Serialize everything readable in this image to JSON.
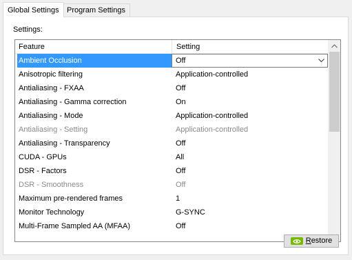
{
  "tabs": [
    {
      "label": "Global Settings"
    },
    {
      "label": "Program Settings"
    }
  ],
  "settings_label": "Settings:",
  "table": {
    "columns": [
      "Feature",
      "Setting"
    ],
    "rows": [
      {
        "feature": "Ambient Occlusion",
        "setting": "Off"
      },
      {
        "feature": "Anisotropic filtering",
        "setting": "Application-controlled"
      },
      {
        "feature": "Antialiasing - FXAA",
        "setting": "Off"
      },
      {
        "feature": "Antialiasing - Gamma correction",
        "setting": "On"
      },
      {
        "feature": "Antialiasing - Mode",
        "setting": "Application-controlled"
      },
      {
        "feature": "Antialiasing - Setting",
        "setting": "Application-controlled"
      },
      {
        "feature": "Antialiasing - Transparency",
        "setting": "Off"
      },
      {
        "feature": "CUDA - GPUs",
        "setting": "All"
      },
      {
        "feature": "DSR - Factors",
        "setting": "Off"
      },
      {
        "feature": "DSR - Smoothness",
        "setting": "Off"
      },
      {
        "feature": "Maximum pre-rendered frames",
        "setting": "1"
      },
      {
        "feature": "Monitor Technology",
        "setting": "G-SYNC"
      },
      {
        "feature": "Multi-Frame Sampled AA (MFAA)",
        "setting": "Off"
      }
    ]
  },
  "restore_button": {
    "label_first": "R",
    "label_rest": "estore"
  },
  "colors": {
    "selection": "#3399ff",
    "nvidia_green": "#76b900"
  }
}
